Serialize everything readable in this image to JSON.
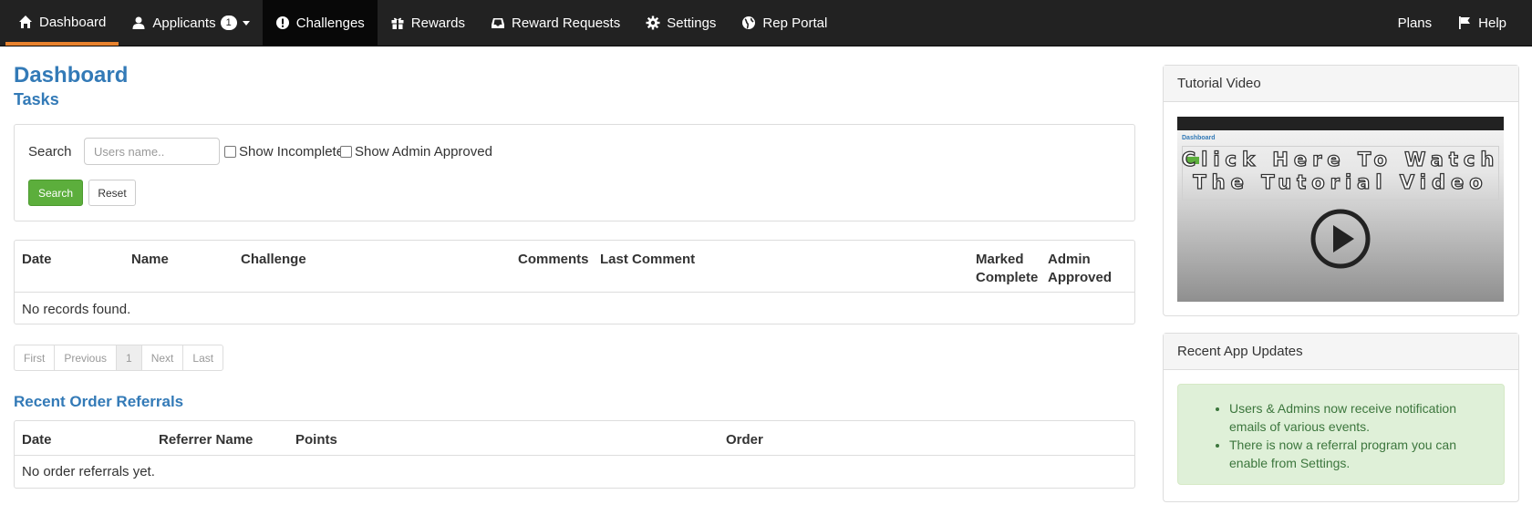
{
  "nav": {
    "left": [
      {
        "label": "Dashboard",
        "icon": "home-icon",
        "active": true
      },
      {
        "label": "Applicants",
        "icon": "user-icon",
        "badge": "1",
        "dropdown": true
      },
      {
        "label": "Challenges",
        "icon": "exclamation-circle-icon",
        "hover": true
      },
      {
        "label": "Rewards",
        "icon": "gift-icon"
      },
      {
        "label": "Reward Requests",
        "icon": "inbox-icon"
      },
      {
        "label": "Settings",
        "icon": "gear-icon"
      },
      {
        "label": "Rep Portal",
        "icon": "globe-icon"
      }
    ],
    "right": [
      {
        "label": "Plans"
      },
      {
        "label": "Help",
        "icon": "flag-icon"
      }
    ],
    "active_color": "#e8822d"
  },
  "main": {
    "title": "Dashboard",
    "tasks": {
      "heading": "Tasks",
      "search_label": "Search",
      "search_placeholder": "Users name..",
      "show_incomplete": "Show Incomplete",
      "show_admin_approved": "Show Admin Approved",
      "search_button": "Search",
      "reset_button": "Reset"
    },
    "tasks_table": {
      "columns": [
        "Date",
        "Name",
        "Challenge",
        "Comments",
        "Last Comment",
        "Marked Complete",
        "Admin Approved"
      ],
      "empty": "No records found."
    },
    "pager": [
      "First",
      "Previous",
      "1",
      "Next",
      "Last"
    ],
    "referrals": {
      "heading": "Recent Order Referrals",
      "columns": [
        "Date",
        "Referrer Name",
        "Points",
        "Order"
      ],
      "empty": "No order referrals yet."
    }
  },
  "side": {
    "tutorial": {
      "heading": "Tutorial Video",
      "overlay_line1": "Click Here To Watch",
      "overlay_line2": "The Tutorial Video"
    },
    "updates": {
      "heading": "Recent App Updates",
      "items": [
        "Users & Admins now receive notification emails of various events.",
        "There is now a referral program you can enable from Settings."
      ]
    }
  },
  "colors": {
    "link_blue": "#337ab7",
    "success_green": "#5cae3c",
    "navbar_bg": "#222222"
  }
}
